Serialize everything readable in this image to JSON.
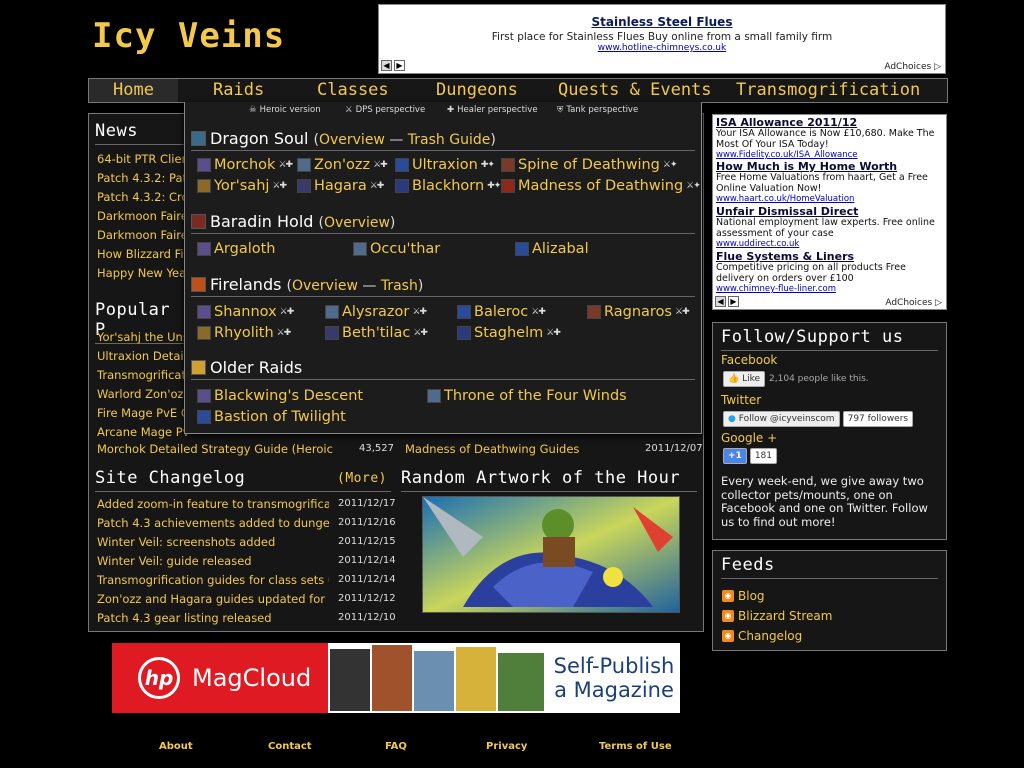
{
  "site": {
    "logo": "Icy Veins"
  },
  "top_ad": {
    "title": "Stainless Steel Flues",
    "text": "First place for Stainless Flues Buy online from a small family firm",
    "url": "www.hotline-chimneys.co.uk",
    "choices": "AdChoices ▷"
  },
  "nav": {
    "items": [
      "Home",
      "Raids",
      "Classes",
      "Dungeons",
      "Quests & Events",
      "Transmogrification"
    ]
  },
  "dropdown": {
    "legend": [
      "Heroic version",
      "DPS perspective",
      "Healer perspective",
      "Tank perspective"
    ],
    "sections": [
      {
        "title": "Dragon Soul",
        "links": [
          "Overview",
          "Trash Guide"
        ]
      },
      {
        "title": "Baradin Hold",
        "links": [
          "Overview"
        ]
      },
      {
        "title": "Firelands",
        "links": [
          "Overview",
          "Trash"
        ]
      },
      {
        "title": "Older Raids",
        "links": []
      }
    ],
    "dragon_soul": [
      "Morchok",
      "Zon'ozz",
      "Ultraxion",
      "Spine of Deathwing",
      "Yor'sahj",
      "Hagara",
      "Blackhorn",
      "Madness of Deathwing"
    ],
    "baradin": [
      "Argaloth",
      "Occu'thar",
      "Alizabal"
    ],
    "firelands": [
      "Shannox",
      "Alysrazor",
      "Baleroc",
      "Ragnaros",
      "Rhyolith",
      "Beth'tilac",
      "Staghelm"
    ],
    "older": [
      "Blackwing's Descent",
      "Throne of the Four Winds",
      "Bastion of Twilight"
    ]
  },
  "news": {
    "title": "News",
    "items": [
      "64-bit PTR Clien",
      "Patch 4.3.2: Patc",
      "Patch 4.3.2: Cros",
      "Darkmoon Faire",
      "Darkmoon Faire",
      "How Blizzard Fig",
      "Happy New Year"
    ]
  },
  "popular": {
    "title": "Popular P",
    "items": [
      "Yor'sahj the Unsl",
      "Ultraxion Detaile",
      "Transmogrificati",
      "Warlord Zon'ozz",
      "Fire Mage PvE Gu",
      "Arcane Mage PvE"
    ],
    "last_left": {
      "label": "Morchok Detailed Strategy Guide (Heroic M...",
      "count": "43,527"
    },
    "last_right": {
      "label": "Madness of Deathwing Guides",
      "date": "2011/12/07"
    }
  },
  "changelog": {
    "title": "Site Changelog",
    "more": "(More)",
    "items": [
      {
        "label": "Added zoom-in feature to transmogrifica...",
        "date": "2011/12/17"
      },
      {
        "label": "Patch 4.3 achievements added to dungeo...",
        "date": "2011/12/16"
      },
      {
        "label": "Winter Veil: screenshots added",
        "date": "2011/12/15"
      },
      {
        "label": "Winter Veil: guide released",
        "date": "2011/12/14"
      },
      {
        "label": "Transmogrification guides for class sets u...",
        "date": "2011/12/14"
      },
      {
        "label": "Zon'ozz and Hagara guides updated for h...",
        "date": "2011/12/12"
      },
      {
        "label": "Patch 4.3 gear listing released",
        "date": "2011/12/10"
      }
    ]
  },
  "artwork": {
    "title": "Random Artwork of the Hour"
  },
  "side_ads": [
    {
      "title": "ISA Allowance 2011/12",
      "text": "Your ISA Allowance is Now £10,680. Make The Most Of Your ISA Today!",
      "url": "www.Fidelity.co.uk/ISA_Allowance"
    },
    {
      "title": "How Much is My Home Worth",
      "text": "Free Home Valuations from haart, Get a Free Online Valuation Now!",
      "url": "www.haart.co.uk/HomeValuation"
    },
    {
      "title": "Unfair Dismissal Direct",
      "text": "National employment law experts. Free online assessment of your case",
      "url": "www.uddirect.co.uk"
    },
    {
      "title": "Flue Systems & Liners",
      "text": "Competitive pricing on all products Free delivery on orders over £100",
      "url": "www.chimney-flue-liner.com"
    }
  ],
  "side_ad_choices": "AdChoices ▷",
  "follow": {
    "title": "Follow/Support us",
    "facebook": "Facebook",
    "like": "Like",
    "like_count": "2,104 people like this.",
    "twitter": "Twitter",
    "follow_btn": "Follow @icyveinscom",
    "followers": "797 followers",
    "google": "Google +",
    "plus": "+1",
    "plus_count": "181",
    "text": "Every week-end, we give away two collector pets/mounts, one on Facebook and one on Twitter. Follow us to find out more!"
  },
  "feeds": {
    "title": "Feeds",
    "items": [
      "Blog",
      "Blizzard Stream",
      "Changelog"
    ]
  },
  "bottom_ad": {
    "brand": "MagCloud",
    "logo": "hp",
    "slogan1": "Self-Publish",
    "slogan2": "a Magazine"
  },
  "footer": [
    "About",
    "Contact",
    "FAQ",
    "Privacy",
    "Terms of Use"
  ]
}
